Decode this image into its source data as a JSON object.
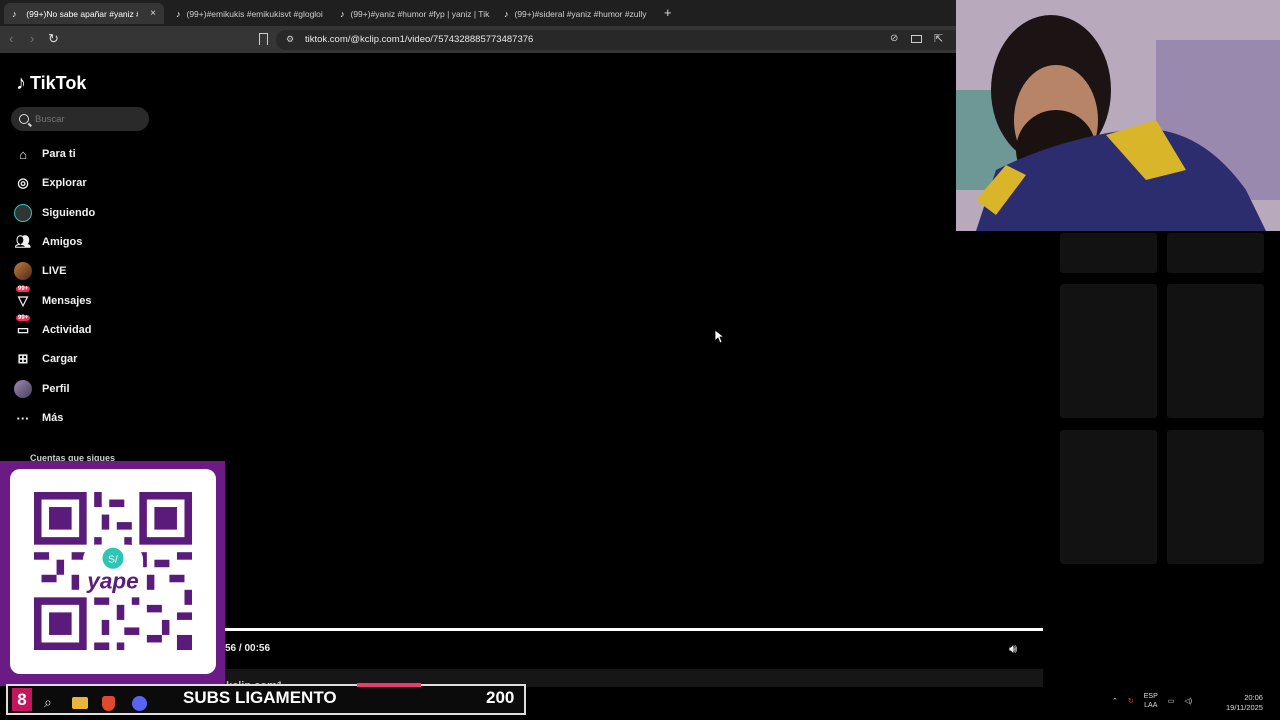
{
  "browser": {
    "tabs": [
      {
        "label": "(99+)No sabe apañar #yaniz #m",
        "close": "×"
      },
      {
        "label": "(99+)#emikukis #emikukisvt #glogloi"
      },
      {
        "label": "(99+)#yaniz #humor #fyp | yaniz | Tik"
      },
      {
        "label": "(99+)#sideral #yaniz #humor #zully"
      }
    ],
    "new_tab": "+",
    "url": "tiktok.com/@kclip.com1/video/7574328885773487376"
  },
  "sidebar": {
    "brand": "TikTok",
    "search_placeholder": "Buscar",
    "items": [
      {
        "label": "Para ti"
      },
      {
        "label": "Explorar"
      },
      {
        "label": "Siguiendo"
      },
      {
        "label": "Amigos"
      },
      {
        "label": "LIVE"
      },
      {
        "label": "Mensajes",
        "badge": "99+"
      },
      {
        "label": "Actividad",
        "badge": "99+"
      },
      {
        "label": "Cargar"
      },
      {
        "label": "Perfil"
      },
      {
        "label": "Más"
      }
    ],
    "following_header": "Cuentas que sigues"
  },
  "player": {
    "time": "56 / 00:56",
    "progress": 1.0,
    "author": "kclip.com1"
  },
  "qr": {
    "brand": "yape",
    "symbol": "S/"
  },
  "overlay": {
    "subs_count": "8",
    "subs_label": "SUBS LIGAMENTO",
    "subs_goal": "200"
  },
  "taskbar": {
    "lang_top": "ESP",
    "lang_bottom": "LAA",
    "time": "20:06",
    "date": "19/11/2025"
  },
  "colors": {
    "accent": "#fe2c55",
    "qr_panel": "#6a1b85",
    "overlay_badge": "#c2185b"
  }
}
